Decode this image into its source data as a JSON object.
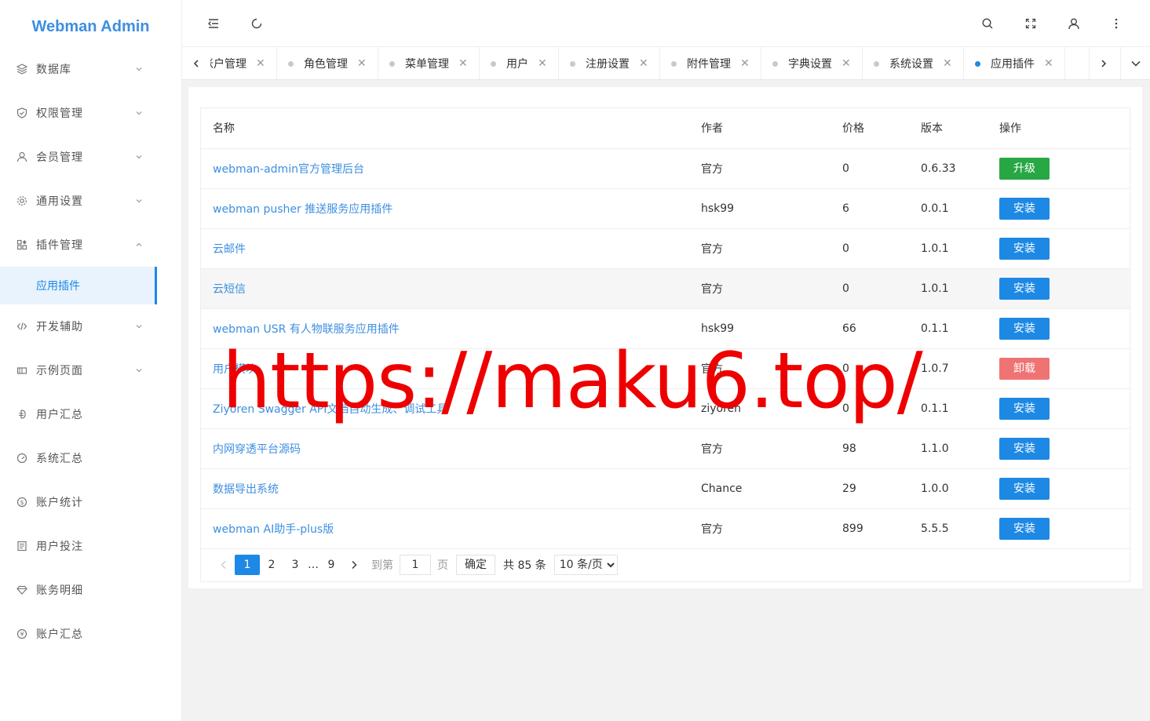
{
  "app": {
    "title": "Webman Admin"
  },
  "sidebar": {
    "items": [
      {
        "label": "数据库",
        "icon": "database-icon",
        "expanded": false
      },
      {
        "label": "权限管理",
        "icon": "shield-icon",
        "expanded": false
      },
      {
        "label": "会员管理",
        "icon": "user-icon",
        "expanded": false
      },
      {
        "label": "通用设置",
        "icon": "gear-icon",
        "expanded": false
      },
      {
        "label": "插件管理",
        "icon": "apps-icon",
        "expanded": true
      },
      {
        "label": "开发辅助",
        "icon": "code-icon",
        "expanded": false
      },
      {
        "label": "示例页面",
        "icon": "layout-icon",
        "expanded": false
      },
      {
        "label": "用户汇总",
        "icon": "currency-icon",
        "expanded": null
      },
      {
        "label": "系统汇总",
        "icon": "gauge-icon",
        "expanded": null
      },
      {
        "label": "账户统计",
        "icon": "dollar-circle-icon",
        "expanded": null
      },
      {
        "label": "用户投注",
        "icon": "document-icon",
        "expanded": null
      },
      {
        "label": "账务明细",
        "icon": "diamond-icon",
        "expanded": null
      },
      {
        "label": "账户汇总",
        "icon": "yen-circle-icon",
        "expanded": null
      }
    ],
    "subitem": {
      "label": "应用插件"
    }
  },
  "tabs": [
    {
      "label": "账户管理",
      "active": false
    },
    {
      "label": "角色管理",
      "active": false
    },
    {
      "label": "菜单管理",
      "active": false
    },
    {
      "label": "用户",
      "active": false
    },
    {
      "label": "注册设置",
      "active": false
    },
    {
      "label": "附件管理",
      "active": false
    },
    {
      "label": "字典设置",
      "active": false
    },
    {
      "label": "系统设置",
      "active": false
    },
    {
      "label": "应用插件",
      "active": true
    }
  ],
  "table": {
    "headers": {
      "name": "名称",
      "author": "作者",
      "price": "价格",
      "version": "版本",
      "action": "操作"
    },
    "rows": [
      {
        "name": "webman-admin官方管理后台",
        "author": "官方",
        "price": "0",
        "version": "0.6.33",
        "action": "升级",
        "kind": "upgrade"
      },
      {
        "name": "webman pusher 推送服务应用插件",
        "author": "hsk99",
        "price": "6",
        "version": "0.0.1",
        "action": "安装",
        "kind": "install"
      },
      {
        "name": "云邮件",
        "author": "官方",
        "price": "0",
        "version": "1.0.1",
        "action": "安装",
        "kind": "install"
      },
      {
        "name": "云短信",
        "author": "官方",
        "price": "0",
        "version": "1.0.1",
        "action": "安装",
        "kind": "install"
      },
      {
        "name": "webman USR 有人物联服务应用插件",
        "author": "hsk99",
        "price": "66",
        "version": "0.1.1",
        "action": "安装",
        "kind": "install"
      },
      {
        "name": "用户模块",
        "author": "官方",
        "price": "0",
        "version": "1.0.7",
        "action": "卸载",
        "kind": "uninstall"
      },
      {
        "name": "Ziyoren Swagger API文档自动生成、调试工具",
        "author": "ziyoren",
        "price": "0",
        "version": "0.1.1",
        "action": "安装",
        "kind": "install"
      },
      {
        "name": "内网穿透平台源码",
        "author": "官方",
        "price": "98",
        "version": "1.1.0",
        "action": "安装",
        "kind": "install"
      },
      {
        "name": "数据导出系统",
        "author": "Chance",
        "price": "29",
        "version": "1.0.0",
        "action": "安装",
        "kind": "install"
      },
      {
        "name": "webman AI助手-plus版",
        "author": "官方",
        "price": "899",
        "version": "5.5.5",
        "action": "安装",
        "kind": "install"
      }
    ]
  },
  "pagination": {
    "pages": [
      "1",
      "2",
      "3"
    ],
    "ellipsis": "…",
    "last_page": "9",
    "goto_label": "到第",
    "goto_value": "1",
    "page_unit": "页",
    "confirm": "确定",
    "total": "共 85 条",
    "page_size": "10 条/页"
  },
  "watermark": {
    "text": "https://maku6.top/"
  },
  "colors": {
    "accent": "#1e88e5",
    "upgrade": "#28a745",
    "uninstall": "#f07373",
    "watermark": "#ee0000"
  }
}
